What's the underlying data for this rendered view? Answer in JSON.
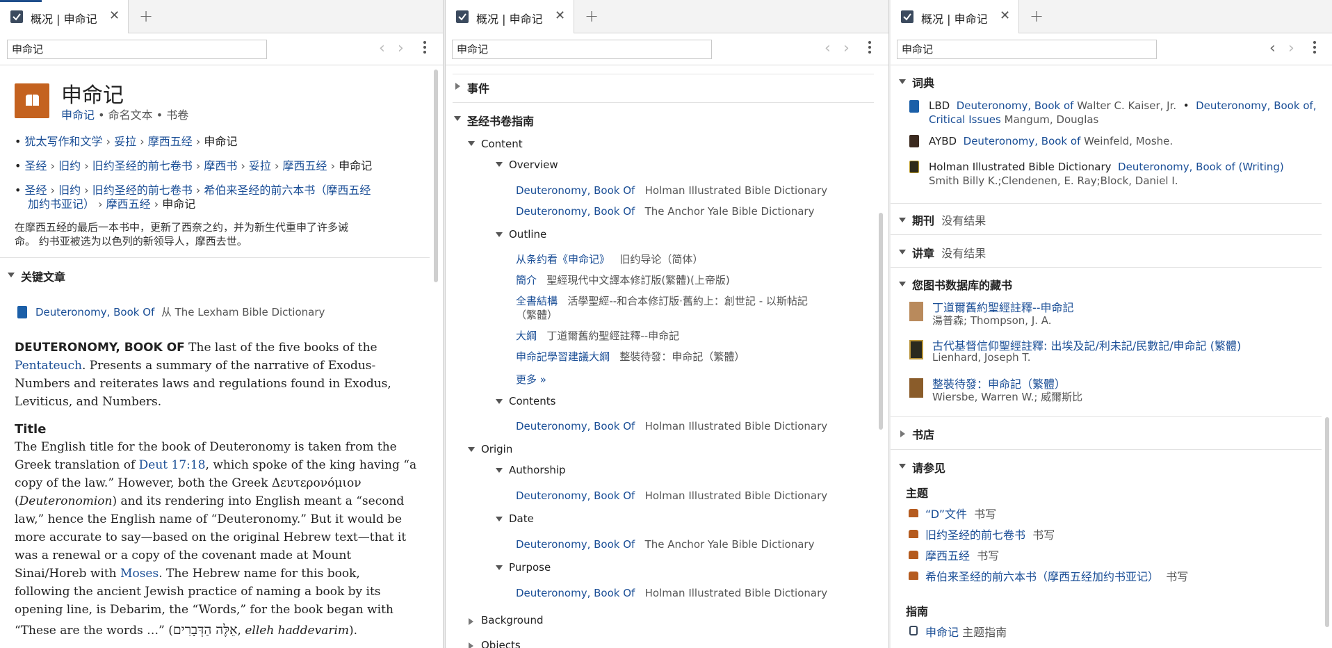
{
  "tab_title": "概况 | 申命记",
  "search_value": "申命记",
  "icons": {
    "tab": "checkmark-icon",
    "close": "close-icon",
    "add": "plus-icon",
    "back": "chevron-left-icon",
    "forward": "chevron-right-icon",
    "menu": "kebab-icon"
  },
  "p1": {
    "title": "申命记",
    "subtitle_link": "申命记",
    "subtitle_rest": "• 命名文本 • 书卷",
    "bread1": [
      "犹太写作和文学",
      "妥拉",
      "摩西五经"
    ],
    "bread1_last": "申命记",
    "bread2": [
      "圣经",
      "旧约",
      "旧约圣经的前七卷书",
      "摩西书",
      "妥拉",
      "摩西五经"
    ],
    "bread2_last": "申命记",
    "bread3_a": [
      "圣经",
      "旧约",
      "旧约圣经的前七卷书"
    ],
    "bread3_long": "希伯来圣经的前六本书（摩西五经",
    "bread3_long2": "加约书亚记）",
    "bread3_b": "摩西五经",
    "bread3_last": "申命记",
    "summary_l1": "在摩西五经的最后一本书中，更新了西奈之约，并为新生代重申了许多诫",
    "summary_l2": "命。 约书亚被选为以色列的新领导人，摩西去世。",
    "key_header": "关键文章",
    "key_link": "Deuteronomy, Book Of",
    "key_from": "从 The Lexham Bible Dictionary",
    "art_heading": "DEUTERONOMY, BOOK OF",
    "art_l1_rest": " The last of the five books of the",
    "art_l2_link": "Pentateuch",
    "art_l2_rest": ". Presents a summary of the narrative of Exodus-",
    "art_l3": "Numbers and reiterates laws and regulations found in Exodus,",
    "art_l4": "Leviticus, and Numbers.",
    "title_heading": "Title",
    "t_l1": "The English title for the book of Deuteronomy is taken from the",
    "t_l2a": "Greek translation of ",
    "t_l2_link": "Deut 17:18",
    "t_l2b": ", which spoke of the king having “a",
    "t_l3": "copy of the law.” However, both the Greek Δευτερονόμιον",
    "t_l4a": "(",
    "t_l4_ital": "Deuteronomion",
    "t_l4b": ") and its rendering into English meant a “second",
    "t_l5": "law,” hence the English name of “Deuteronomy.” But it would be",
    "t_l6": "more accurate to say—based on the original Hebrew text—that it",
    "t_l7": "was a renewal or a copy of the covenant made at Mount",
    "t_l8a": "Sinai/Horeb with ",
    "t_l8_link": "Moses",
    "t_l8b": ". The Hebrew name for this book,",
    "t_l9": "following the ancient Jewish practice of naming a book by its",
    "t_l10": "opening line, is Debarim, the “Words,” for the book began with",
    "t_l11a": "“These are the words …” (",
    "t_l11_heb": "אֵלֶּה הַדְּבָרִים",
    "t_l11b": ", ",
    "t_l11_ital": "elleh haddevarim",
    "t_l11c": ")."
  },
  "p2": {
    "events": "事件",
    "guide": "圣经书卷指南",
    "content": "Content",
    "overview": "Overview",
    "ov": [
      {
        "link": "Deuteronomy, Book Of",
        "src": "Holman Illustrated Bible Dictionary"
      },
      {
        "link": "Deuteronomy, Book Of",
        "src": "The Anchor Yale Bible Dictionary"
      }
    ],
    "outline": "Outline",
    "ol1_link": "从条约看《申命记》",
    "ol1_src": "旧约导论（简体）",
    "ol2_link": "簡介",
    "ol2_src": "聖經現代中文譯本修訂版(繁體)(上帝版)",
    "ol3_link": "全書結構",
    "ol3_src": "活學聖經--和合本修訂版·舊約上：創世記 - 以斯帖記",
    "ol3_src2": "（繁體）",
    "ol4_link": "大綱",
    "ol4_src": "丁道爾舊約聖經註釋--申命記",
    "ol5_link": "申命記學習建議大綱",
    "ol5_src": "整裝待發：申命記（繁體）",
    "more": "更多 »",
    "contents": "Contents",
    "ct_link": "Deuteronomy, Book Of",
    "ct_src": "Holman Illustrated Bible Dictionary",
    "origin": "Origin",
    "authorship": "Authorship",
    "au_link": "Deuteronomy, Book Of",
    "au_src": "Holman Illustrated Bible Dictionary",
    "date": "Date",
    "dt_link": "Deuteronomy, Book Of",
    "dt_src": "The Anchor Yale Bible Dictionary",
    "purpose": "Purpose",
    "pu_link": "Deuteronomy, Book Of",
    "pu_src": "Holman Illustrated Bible Dictionary",
    "background": "Background",
    "objects": "Objects"
  },
  "p3": {
    "dict": "词典",
    "lbd_abbr": "LBD",
    "lbd_link1": "Deuteronomy, Book of",
    "lbd_auth1": "Walter C. Kaiser, Jr.",
    "lbd_link2a": "Deuteronomy, Book of,",
    "lbd_link2b": "Critical Issues",
    "lbd_auth2": "Mangum, Douglas",
    "aybd_abbr": "AYBD",
    "aybd_link": "Deuteronomy, Book of",
    "aybd_auth": "Weinfeld, Moshe.",
    "hol_abbr": "Holman Illustrated Bible Dictionary",
    "hol_link": "Deuteronomy, Book of (Writing)",
    "hol_auth": "Smith Billy K.;Clendenen, E. Ray;Block, Daniel I.",
    "journals": "期刊",
    "journals_none": "没有结果",
    "sermons": "讲章",
    "sermons_none": "没有结果",
    "library": "您图书数据库的藏书",
    "lib": [
      {
        "title": "丁道爾舊約聖經註釋--申命記",
        "author": "湯普森; Thompson, J. A."
      },
      {
        "title": "古代基督信仰聖經註釋: 出埃及記/利未記/民數記/申命記 (繁體)",
        "author": "Lienhard, Joseph T."
      },
      {
        "title": "整裝待發：申命記（繁體）",
        "author": "Wiersbe, Warren W.; 威爾斯比"
      }
    ],
    "store": "书店",
    "seealso": "请参见",
    "topics_h": "主题",
    "topics": [
      {
        "link": "“D”文件",
        "type": "书写"
      },
      {
        "link": "旧约圣经的前七卷书",
        "type": "书写"
      },
      {
        "link": "摩西五经",
        "type": "书写"
      },
      {
        "link": "希伯来圣经的前六本书（摩西五经加约书亚记）",
        "type": "书写"
      }
    ],
    "guides_h": "指南",
    "guide_link": "申命记",
    "guide_type": "主题指南"
  }
}
